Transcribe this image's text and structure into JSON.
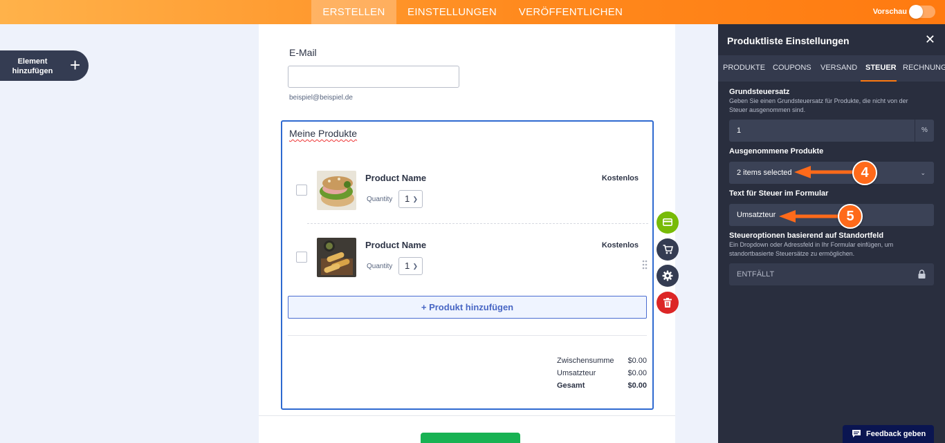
{
  "topbar": {
    "tabs": [
      {
        "label": "ERSTELLEN",
        "active": true
      },
      {
        "label": "EINSTELLUNGEN",
        "active": false
      },
      {
        "label": "VERÖFFENTLICHEN",
        "active": false
      }
    ],
    "preview_label": "Vorschau",
    "preview_toggle_on": false
  },
  "add_element": {
    "label": "Element hinzufügen",
    "icon": "plus-icon"
  },
  "form": {
    "email_label": "E-Mail",
    "email_value": "",
    "email_hint": "beispiel@beispiel.de",
    "product_list_title": "Meine Produkte",
    "products": [
      {
        "name": "Product Name",
        "price": "Kostenlos",
        "quantity_label": "Quantity",
        "quantity": "1",
        "image": "sandwich",
        "checked": false
      },
      {
        "name": "Product Name",
        "price": "Kostenlos",
        "quantity_label": "Quantity",
        "quantity": "1",
        "image": "spring-rolls",
        "checked": false
      }
    ],
    "add_product_label": "+ Produkt hinzufügen",
    "totals": [
      {
        "label": "Zwischensumme",
        "value": "$0.00",
        "bold": false
      },
      {
        "label": "Umsatzteur",
        "value": "$0.00",
        "bold": false
      },
      {
        "label": "Gesamt",
        "value": "$0.00",
        "bold": true
      }
    ]
  },
  "side_actions": [
    {
      "icon": "payment-card-icon",
      "color": "#78bb07"
    },
    {
      "icon": "cart-icon",
      "color": "#343c52"
    },
    {
      "icon": "gear-icon",
      "color": "#343c52"
    },
    {
      "icon": "trash-icon",
      "color": "#dc2626"
    }
  ],
  "panel": {
    "title": "Produktliste Einstellungen",
    "tabs": [
      {
        "label": "PRODUKTE",
        "active": false
      },
      {
        "label": "COUPONS",
        "active": false
      },
      {
        "label": "VERSAND",
        "active": false
      },
      {
        "label": "STEUER",
        "active": true
      },
      {
        "label": "RECHNUNG",
        "active": false
      }
    ],
    "base_tax": {
      "label": "Grundsteuersatz",
      "description": "Geben Sie einen Grundsteuersatz für Produkte, die nicht von der Steuer ausgenommen sind.",
      "value": "1",
      "suffix": "%"
    },
    "excluded_products": {
      "label": "Ausgenommene Produkte",
      "value": "2 items selected"
    },
    "tax_text": {
      "label": "Text für Steuer im Formular",
      "value": "Umsatzteur"
    },
    "location_tax": {
      "label": "Steueroptionen basierend auf Standortfeld",
      "description": "Ein Dropdown oder Adressfeld in Ihr Formular einfügen, um standortbasierte Steuersätze zu ermöglichen.",
      "value": "ENTFÄLLT"
    }
  },
  "feedback_label": "Feedback geben",
  "annotations": [
    {
      "number": "4"
    },
    {
      "number": "5"
    }
  ],
  "colors": {
    "accent": "#ff7a10",
    "panel_bg": "#292e3e",
    "field_bg": "#3b4256",
    "selected_border": "#2e69d0",
    "submit": "#18b253"
  }
}
